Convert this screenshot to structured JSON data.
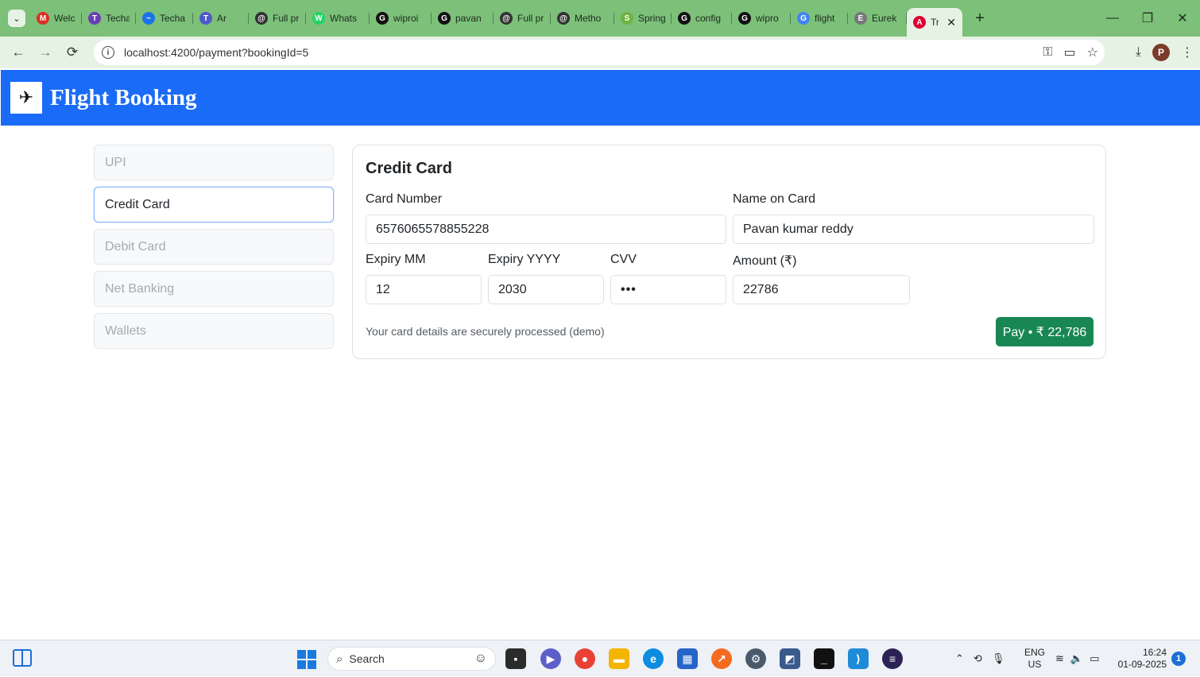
{
  "browser": {
    "tabs": [
      {
        "label": "Welco",
        "icon": "gmail-icon",
        "color": "#d93025",
        "glyph": "M"
      },
      {
        "label": "Techa",
        "icon": "techademy-icon",
        "color": "#6a3fb5",
        "glyph": "T"
      },
      {
        "label": "Techa",
        "icon": "chart-icon",
        "color": "#1a73e8",
        "glyph": "~"
      },
      {
        "label": "Ar",
        "icon": "teams-icon",
        "color": "#5059c9",
        "glyph": "T"
      },
      {
        "label": "Full pr",
        "icon": "openai-icon",
        "color": "#333333",
        "glyph": "@"
      },
      {
        "label": "Whats",
        "icon": "whatsapp-icon",
        "color": "#25d366",
        "glyph": "W"
      },
      {
        "label": "wiproi",
        "icon": "github-icon",
        "color": "#111111",
        "glyph": "G"
      },
      {
        "label": "pavan",
        "icon": "github-icon",
        "color": "#111111",
        "glyph": "G"
      },
      {
        "label": "Full pr",
        "icon": "openai-icon",
        "color": "#333333",
        "glyph": "@"
      },
      {
        "label": "Metho",
        "icon": "openai-icon",
        "color": "#333333",
        "glyph": "@"
      },
      {
        "label": "Spring",
        "icon": "spring-icon",
        "color": "#6db33f",
        "glyph": "S"
      },
      {
        "label": "config",
        "icon": "github-icon",
        "color": "#111111",
        "glyph": "G"
      },
      {
        "label": "wipro",
        "icon": "github-icon",
        "color": "#111111",
        "glyph": "G"
      },
      {
        "label": "flight",
        "icon": "google-icon",
        "color": "#4285f4",
        "glyph": "G"
      },
      {
        "label": "Eurek",
        "icon": "globe-icon",
        "color": "#777777",
        "glyph": "E"
      }
    ],
    "active_tab": {
      "label": "Tr",
      "icon": "angular-icon",
      "color": "#dd0031",
      "glyph": "A"
    },
    "url": "localhost:4200/payment?bookingId=5",
    "profile_initial": "P"
  },
  "app": {
    "brand": "Flight Booking",
    "logo_icon": "airplane-icon"
  },
  "payment": {
    "methods": [
      {
        "label": "UPI",
        "active": false
      },
      {
        "label": "Credit Card",
        "active": true
      },
      {
        "label": "Debit Card",
        "active": false
      },
      {
        "label": "Net Banking",
        "active": false
      },
      {
        "label": "Wallets",
        "active": false
      }
    ],
    "form": {
      "title": "Credit Card",
      "card_number_label": "Card Number",
      "card_number_value": "6576065578855228",
      "name_label": "Name on Card",
      "name_value": "Pavan kumar reddy",
      "expiry_mm_label": "Expiry MM",
      "expiry_mm_value": "12",
      "expiry_yyyy_label": "Expiry YYYY",
      "expiry_yyyy_value": "2030",
      "cvv_label": "CVV",
      "cvv_value": "•••",
      "amount_label": "Amount (₹)",
      "amount_value": "22786",
      "note": "Your card details are securely processed (demo)",
      "pay_label": "Pay • ₹ 22,786",
      "pay_color": "#198754"
    }
  },
  "taskbar": {
    "search_label": "Search",
    "lang_top": "ENG",
    "lang_bottom": "US",
    "time": "16:24",
    "date": "01-09-2025",
    "notification_count": "1"
  }
}
